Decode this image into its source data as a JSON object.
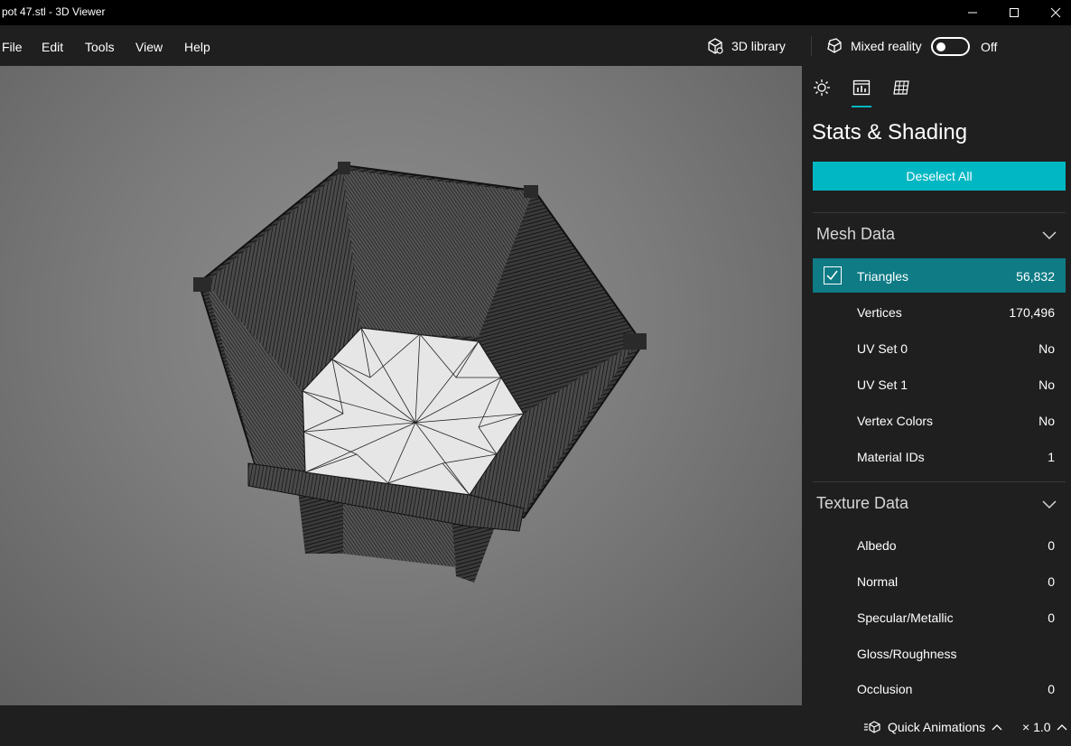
{
  "window": {
    "title": "pot 47.stl - 3D Viewer"
  },
  "menu": {
    "items": [
      "File",
      "Edit",
      "Tools",
      "View",
      "Help"
    ]
  },
  "toolbar": {
    "library_label": "3D library",
    "mixed_reality_label": "Mixed reality",
    "mixed_reality_state": "Off"
  },
  "panel": {
    "tabs": [
      "environment-and-lighting",
      "stats-and-shading",
      "mesh-grid"
    ],
    "active_tab": "stats-and-shading",
    "title": "Stats & Shading",
    "deselect_label": "Deselect All",
    "mesh_section": {
      "title": "Mesh Data",
      "rows": [
        {
          "label": "Triangles",
          "value": "56,832",
          "selected": true
        },
        {
          "label": "Vertices",
          "value": "170,496"
        },
        {
          "label": "UV Set 0",
          "value": "No"
        },
        {
          "label": "UV Set 1",
          "value": "No"
        },
        {
          "label": "Vertex Colors",
          "value": "No"
        },
        {
          "label": "Material IDs",
          "value": "1"
        }
      ]
    },
    "texture_section": {
      "title": "Texture Data",
      "rows": [
        {
          "label": "Albedo",
          "value": "0"
        },
        {
          "label": "Normal",
          "value": "0"
        },
        {
          "label": "Specular/Metallic",
          "value": "0"
        },
        {
          "label": "Gloss/Roughness",
          "value": ""
        },
        {
          "label": "Occlusion",
          "value": "0"
        }
      ]
    }
  },
  "bottom": {
    "quick_animations_label": "Quick Animations",
    "speed_label": "× 1.0"
  },
  "colors": {
    "accent": "#00b7c3",
    "selected_row": "#0e7b85",
    "background": "#1f1f1f"
  }
}
